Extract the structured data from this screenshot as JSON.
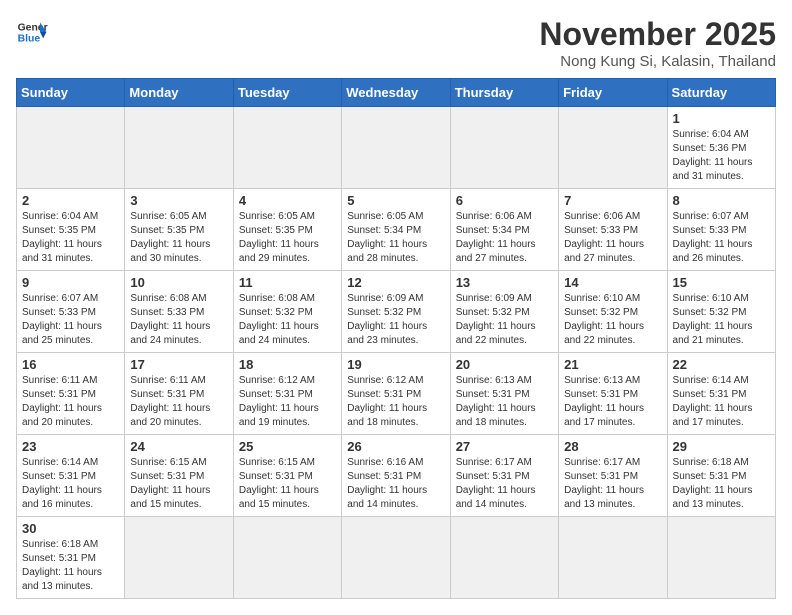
{
  "logo": {
    "text_general": "General",
    "text_blue": "Blue"
  },
  "title": "November 2025",
  "location": "Nong Kung Si, Kalasin, Thailand",
  "days_of_week": [
    "Sunday",
    "Monday",
    "Tuesday",
    "Wednesday",
    "Thursday",
    "Friday",
    "Saturday"
  ],
  "weeks": [
    [
      {
        "num": "",
        "info": ""
      },
      {
        "num": "",
        "info": ""
      },
      {
        "num": "",
        "info": ""
      },
      {
        "num": "",
        "info": ""
      },
      {
        "num": "",
        "info": ""
      },
      {
        "num": "",
        "info": ""
      },
      {
        "num": "1",
        "info": "Sunrise: 6:04 AM\nSunset: 5:36 PM\nDaylight: 11 hours\nand 31 minutes."
      }
    ],
    [
      {
        "num": "2",
        "info": "Sunrise: 6:04 AM\nSunset: 5:35 PM\nDaylight: 11 hours\nand 31 minutes."
      },
      {
        "num": "3",
        "info": "Sunrise: 6:05 AM\nSunset: 5:35 PM\nDaylight: 11 hours\nand 30 minutes."
      },
      {
        "num": "4",
        "info": "Sunrise: 6:05 AM\nSunset: 5:35 PM\nDaylight: 11 hours\nand 29 minutes."
      },
      {
        "num": "5",
        "info": "Sunrise: 6:05 AM\nSunset: 5:34 PM\nDaylight: 11 hours\nand 28 minutes."
      },
      {
        "num": "6",
        "info": "Sunrise: 6:06 AM\nSunset: 5:34 PM\nDaylight: 11 hours\nand 27 minutes."
      },
      {
        "num": "7",
        "info": "Sunrise: 6:06 AM\nSunset: 5:33 PM\nDaylight: 11 hours\nand 27 minutes."
      },
      {
        "num": "8",
        "info": "Sunrise: 6:07 AM\nSunset: 5:33 PM\nDaylight: 11 hours\nand 26 minutes."
      }
    ],
    [
      {
        "num": "9",
        "info": "Sunrise: 6:07 AM\nSunset: 5:33 PM\nDaylight: 11 hours\nand 25 minutes."
      },
      {
        "num": "10",
        "info": "Sunrise: 6:08 AM\nSunset: 5:33 PM\nDaylight: 11 hours\nand 24 minutes."
      },
      {
        "num": "11",
        "info": "Sunrise: 6:08 AM\nSunset: 5:32 PM\nDaylight: 11 hours\nand 24 minutes."
      },
      {
        "num": "12",
        "info": "Sunrise: 6:09 AM\nSunset: 5:32 PM\nDaylight: 11 hours\nand 23 minutes."
      },
      {
        "num": "13",
        "info": "Sunrise: 6:09 AM\nSunset: 5:32 PM\nDaylight: 11 hours\nand 22 minutes."
      },
      {
        "num": "14",
        "info": "Sunrise: 6:10 AM\nSunset: 5:32 PM\nDaylight: 11 hours\nand 22 minutes."
      },
      {
        "num": "15",
        "info": "Sunrise: 6:10 AM\nSunset: 5:32 PM\nDaylight: 11 hours\nand 21 minutes."
      }
    ],
    [
      {
        "num": "16",
        "info": "Sunrise: 6:11 AM\nSunset: 5:31 PM\nDaylight: 11 hours\nand 20 minutes."
      },
      {
        "num": "17",
        "info": "Sunrise: 6:11 AM\nSunset: 5:31 PM\nDaylight: 11 hours\nand 20 minutes."
      },
      {
        "num": "18",
        "info": "Sunrise: 6:12 AM\nSunset: 5:31 PM\nDaylight: 11 hours\nand 19 minutes."
      },
      {
        "num": "19",
        "info": "Sunrise: 6:12 AM\nSunset: 5:31 PM\nDaylight: 11 hours\nand 18 minutes."
      },
      {
        "num": "20",
        "info": "Sunrise: 6:13 AM\nSunset: 5:31 PM\nDaylight: 11 hours\nand 18 minutes."
      },
      {
        "num": "21",
        "info": "Sunrise: 6:13 AM\nSunset: 5:31 PM\nDaylight: 11 hours\nand 17 minutes."
      },
      {
        "num": "22",
        "info": "Sunrise: 6:14 AM\nSunset: 5:31 PM\nDaylight: 11 hours\nand 17 minutes."
      }
    ],
    [
      {
        "num": "23",
        "info": "Sunrise: 6:14 AM\nSunset: 5:31 PM\nDaylight: 11 hours\nand 16 minutes."
      },
      {
        "num": "24",
        "info": "Sunrise: 6:15 AM\nSunset: 5:31 PM\nDaylight: 11 hours\nand 15 minutes."
      },
      {
        "num": "25",
        "info": "Sunrise: 6:15 AM\nSunset: 5:31 PM\nDaylight: 11 hours\nand 15 minutes."
      },
      {
        "num": "26",
        "info": "Sunrise: 6:16 AM\nSunset: 5:31 PM\nDaylight: 11 hours\nand 14 minutes."
      },
      {
        "num": "27",
        "info": "Sunrise: 6:17 AM\nSunset: 5:31 PM\nDaylight: 11 hours\nand 14 minutes."
      },
      {
        "num": "28",
        "info": "Sunrise: 6:17 AM\nSunset: 5:31 PM\nDaylight: 11 hours\nand 13 minutes."
      },
      {
        "num": "29",
        "info": "Sunrise: 6:18 AM\nSunset: 5:31 PM\nDaylight: 11 hours\nand 13 minutes."
      }
    ],
    [
      {
        "num": "30",
        "info": "Sunrise: 6:18 AM\nSunset: 5:31 PM\nDaylight: 11 hours\nand 13 minutes."
      },
      {
        "num": "",
        "info": ""
      },
      {
        "num": "",
        "info": ""
      },
      {
        "num": "",
        "info": ""
      },
      {
        "num": "",
        "info": ""
      },
      {
        "num": "",
        "info": ""
      },
      {
        "num": "",
        "info": ""
      }
    ]
  ]
}
